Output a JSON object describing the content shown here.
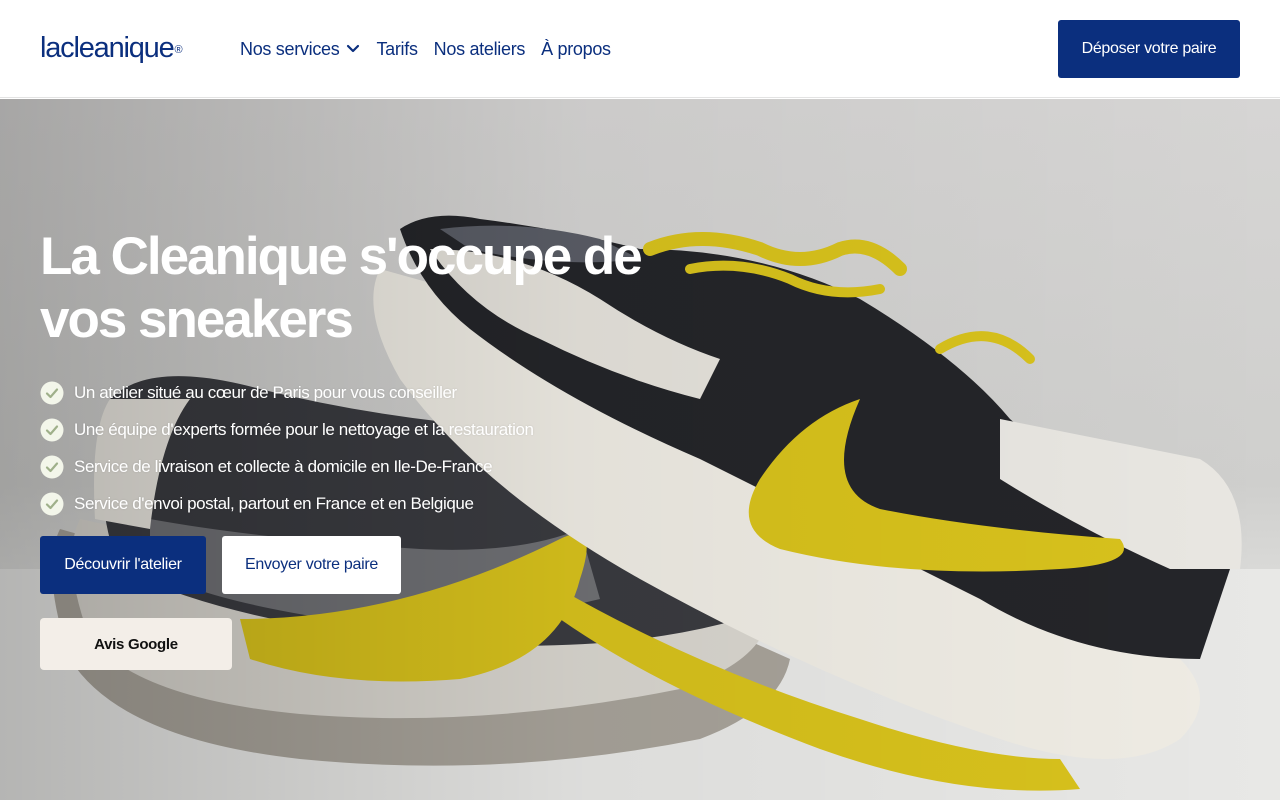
{
  "header": {
    "logo": "lacleanique",
    "logo_mark": "®",
    "nav": [
      {
        "label": "Nos services",
        "has_dropdown": true
      },
      {
        "label": "Tarifs"
      },
      {
        "label": "Nos ateliers"
      },
      {
        "label": "À propos"
      }
    ],
    "cta_label": "Déposer votre paire"
  },
  "hero": {
    "title": "La Cleanique s'occupe de vos sneakers",
    "features": [
      "Un atelier situé au cœur de Paris pour vous conseiller",
      "Une équipe d'experts formée pour le nettoyage et la restauration",
      "Service de livraison et collecte à domicile en Ile-De-France",
      "Service d'envoi postal, partout en France et en Belgique"
    ],
    "primary_button": "Découvrir l'atelier",
    "secondary_button": "Envoyer votre paire",
    "google_button": "Avis Google",
    "background_icon": "sneakers-photo"
  },
  "colors": {
    "brand": "#0b2f7e",
    "white": "#ffffff",
    "google_button_bg": "#f3eee8",
    "sneaker_yellow": "#d8c21c"
  },
  "icons": {
    "check": "check-badge-icon",
    "dropdown": "chevron-down-icon"
  }
}
